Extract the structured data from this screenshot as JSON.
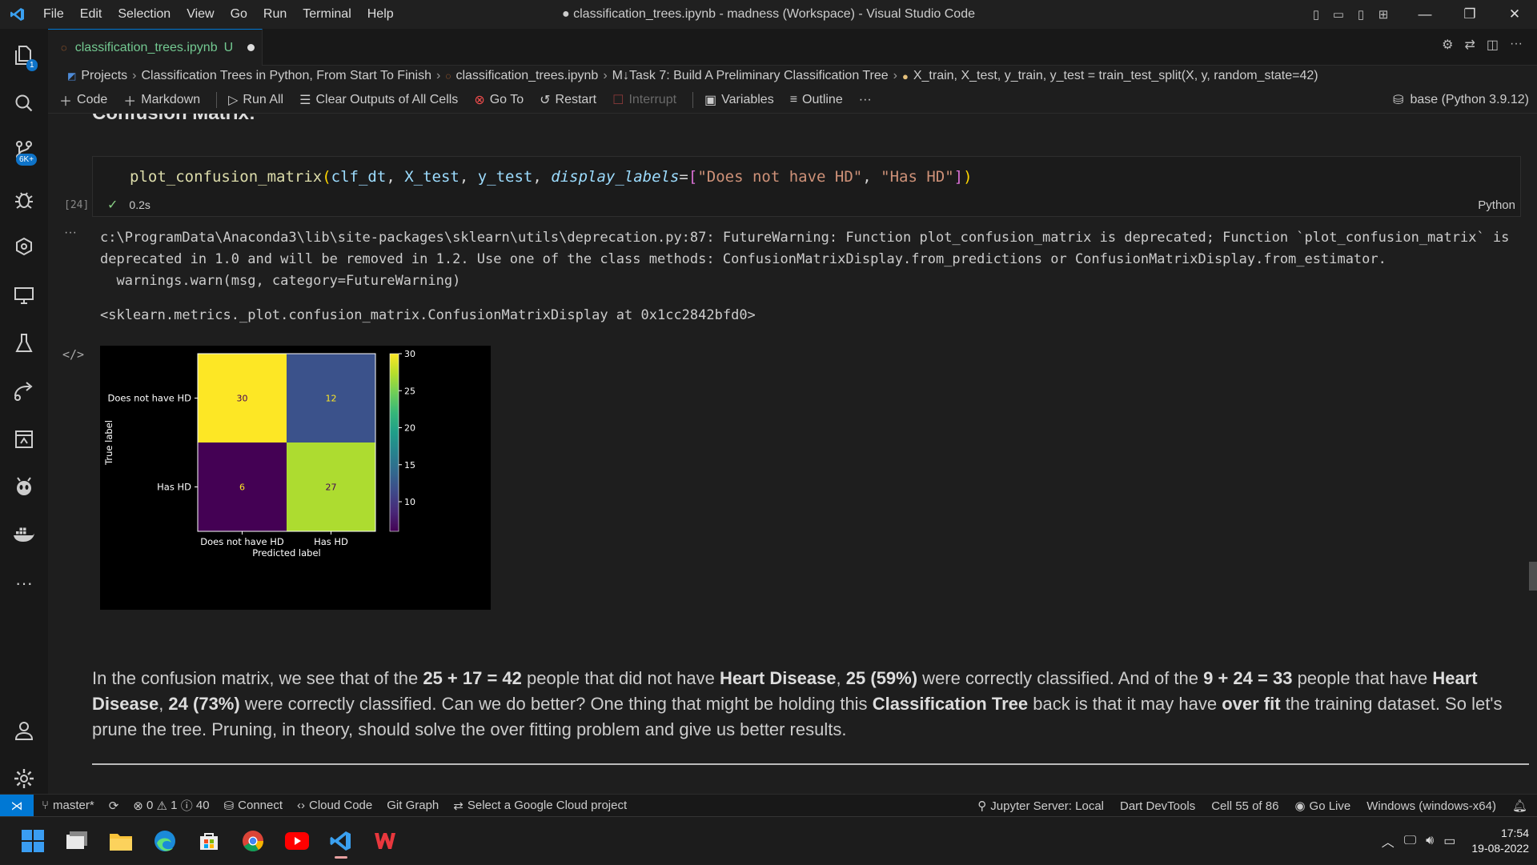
{
  "window": {
    "title": "● classification_trees.ipynb - madness (Workspace) - Visual Studio Code"
  },
  "menu": [
    "File",
    "Edit",
    "Selection",
    "View",
    "Go",
    "Run",
    "Terminal",
    "Help"
  ],
  "activity": {
    "explorer_badge": "1",
    "scm_badge": "6K+"
  },
  "tab": {
    "name": "classification_trees.ipynb",
    "status": "U"
  },
  "breadcrumb": [
    "Projects",
    "Classification Trees in Python, From Start To Finish",
    "classification_trees.ipynb",
    "M↓Task 7: Build A Preliminary Classification Tree",
    "X_train, X_test, y_train, y_test = train_test_split(X, y, random_state=42)"
  ],
  "toolbar": {
    "code": "Code",
    "markdown": "Markdown",
    "run_all": "Run All",
    "clear_outputs": "Clear Outputs of All Cells",
    "go_to": "Go To",
    "restart": "Restart",
    "interrupt": "Interrupt",
    "variables": "Variables",
    "outline": "Outline",
    "more": "···",
    "kernel": "base (Python 3.9.12)"
  },
  "heading": "Confusion Matrix:",
  "cell": {
    "exec_count": "[24]",
    "code": {
      "fn": "plot_confusion_matrix",
      "open": "(",
      "a1": "clf_dt",
      "c1": ", ",
      "a2": "X_test",
      "c2": ", ",
      "a3": "y_test",
      "c3": ", ",
      "kw": "display_labels",
      "eq": "=",
      "lb": "[",
      "s1": "\"Does not have HD\"",
      "c4": ", ",
      "s2": "\"Has HD\"",
      "rb": "]",
      "close": ")"
    },
    "check": "✓",
    "duration": "0.2s",
    "language": "Python"
  },
  "output": {
    "dots": "···",
    "stderr": "c:\\ProgramData\\Anaconda3\\lib\\site-packages\\sklearn\\utils\\deprecation.py:87: FutureWarning: Function plot_confusion_matrix is deprecated; Function `plot_confusion_matrix` is\ndeprecated in 1.0 and will be removed in 1.2. Use one of the class methods: ConfusionMatrixDisplay.from_predictions or ConfusionMatrixDisplay.from_estimator.\n  warnings.warn(msg, category=FutureWarning)",
    "repr": "<sklearn.metrics._plot.confusion_matrix.ConfusionMatrixDisplay at 0x1cc2842bfd0>"
  },
  "chart_data": {
    "type": "heatmap",
    "row_labels": [
      "Does not have HD",
      "Has HD"
    ],
    "col_labels": [
      "Does not have HD",
      "Has HD"
    ],
    "values": [
      [
        30,
        12
      ],
      [
        6,
        27
      ]
    ],
    "xlabel": "Predicted label",
    "ylabel": "True label",
    "colorbar": {
      "ticks": [
        10,
        15,
        20,
        25,
        30
      ],
      "range": [
        6,
        30
      ],
      "colormap": "viridis"
    },
    "colors": {
      "30": "#fde725",
      "12": "#3b528b",
      "6": "#440154",
      "27": "#addc30"
    }
  },
  "prose": {
    "t1": "In the confusion matrix, we see that of the ",
    "b1": "25 + 17 = 42",
    "t2": " people that did not have ",
    "b2": "Heart Disease",
    "t3": ", ",
    "b3": "25 (59%)",
    "t4": " were correctly classified. And of the ",
    "b4": "9 + 24 = 33",
    "t5": " people that have ",
    "b5": "Heart Disease",
    "t6": ", ",
    "b6": "24 (73%)",
    "t7": " were correctly classified. Can we do better? One thing that might be holding this ",
    "b7": "Classification Tree",
    "t8": " back is that it may have ",
    "b8": "over fit",
    "t9": " the training dataset. So let's prune the tree. Pruning, in theory, should solve the over fitting problem and give us better results."
  },
  "status": {
    "branch": "master*",
    "errors": "0",
    "warnings": "1",
    "info": "40",
    "connect": "Connect",
    "cloud_code": "Cloud Code",
    "git_graph": "Git Graph",
    "gcp": "Select a Google Cloud project",
    "jupyter": "Jupyter Server: Local",
    "dart": "Dart DevTools",
    "cell": "Cell 55 of 86",
    "golive": "Go Live",
    "platform": "Windows (windows-x64)"
  },
  "clock": {
    "time": "17:54",
    "date": "19-08-2022"
  }
}
